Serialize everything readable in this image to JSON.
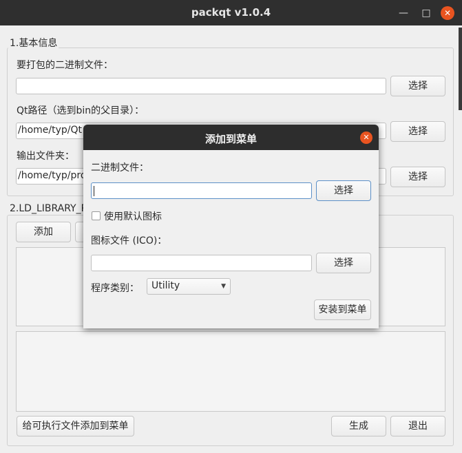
{
  "window": {
    "title": "packqt v1.0.4",
    "min_icon": "minimize-icon",
    "max_icon": "maximize-icon",
    "close_icon": "close-icon"
  },
  "basic_info": {
    "group_title": "1.基本信息",
    "binary_label": "要打包的二进制文件：",
    "binary_value": "",
    "binary_choose": "选择",
    "qt_label": "Qt路径（选到bin的父目录）：",
    "qt_value": "/home/typ/Qt",
    "qt_choose": "选择",
    "output_label": "输出文件夹：",
    "output_value": "/home/typ/pro",
    "output_choose": "选择"
  },
  "ld_library": {
    "group_title": "2.LD_LIBRARY_P",
    "add_button": "添加"
  },
  "footer": {
    "add_to_menu_button": "给可执行文件添加到菜单",
    "generate_button": "生成",
    "exit_button": "退出"
  },
  "dialog": {
    "title": "添加到菜单",
    "binary_label": "二进制文件：",
    "binary_value": "",
    "binary_choose": "选择",
    "default_icon_label": "使用默认图标",
    "default_icon_checked": false,
    "icon_label": "图标文件 (ICO)：",
    "icon_value": "",
    "icon_choose": "选择",
    "category_label": "程序类别：",
    "category_value": "Utility",
    "install_button": "安装到菜单"
  },
  "colors": {
    "titlebar": "#2f2f2f",
    "accent_close": "#e95420",
    "focus_border": "#5b8fc7"
  }
}
